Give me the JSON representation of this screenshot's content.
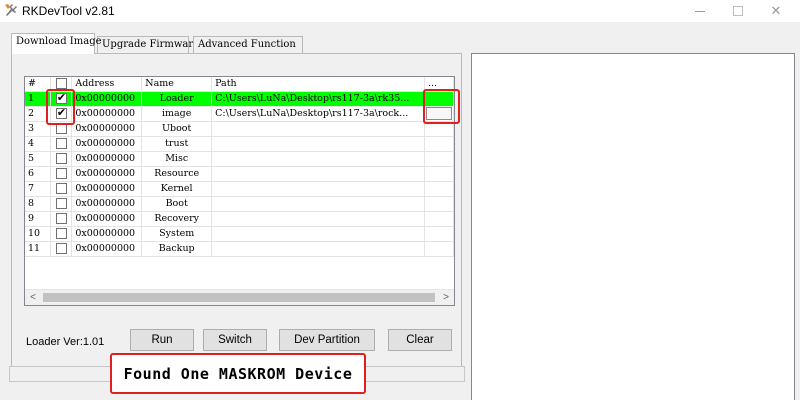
{
  "window": {
    "title": "RKDevTool v2.81",
    "icons": {
      "app": "rk-tool-icon",
      "minimize": "minimize-icon",
      "maximize": "maximize-icon",
      "close": "close-icon"
    }
  },
  "tabs": [
    {
      "label": "Download Image",
      "active": true
    },
    {
      "label": "Upgrade Firmware",
      "active": false
    },
    {
      "label": "Advanced Function",
      "active": false
    }
  ],
  "table": {
    "headers": {
      "num": "#",
      "check": "",
      "address": "Address",
      "name": "Name",
      "path": "Path",
      "browse": "..."
    },
    "rows": [
      {
        "num": "1",
        "checked": true,
        "address": "0x00000000",
        "name": "Loader",
        "path": "C:\\Users\\LuNa\\Desktop\\rs117-3a\\rk35...",
        "highlight": true
      },
      {
        "num": "2",
        "checked": true,
        "address": "0x00000000",
        "name": "image",
        "path": "C:\\Users\\LuNa\\Desktop\\rs117-3a\\rock...",
        "highlight": false
      },
      {
        "num": "3",
        "checked": false,
        "address": "0x00000000",
        "name": "Uboot",
        "path": "",
        "highlight": false
      },
      {
        "num": "4",
        "checked": false,
        "address": "0x00000000",
        "name": "trust",
        "path": "",
        "highlight": false
      },
      {
        "num": "5",
        "checked": false,
        "address": "0x00000000",
        "name": "Misc",
        "path": "",
        "highlight": false
      },
      {
        "num": "6",
        "checked": false,
        "address": "0x00000000",
        "name": "Resource",
        "path": "",
        "highlight": false
      },
      {
        "num": "7",
        "checked": false,
        "address": "0x00000000",
        "name": "Kernel",
        "path": "",
        "highlight": false
      },
      {
        "num": "8",
        "checked": false,
        "address": "0x00000000",
        "name": "Boot",
        "path": "",
        "highlight": false
      },
      {
        "num": "9",
        "checked": false,
        "address": "0x00000000",
        "name": "Recovery",
        "path": "",
        "highlight": false
      },
      {
        "num": "10",
        "checked": false,
        "address": "0x00000000",
        "name": "System",
        "path": "",
        "highlight": false
      },
      {
        "num": "11",
        "checked": false,
        "address": "0x00000000",
        "name": "Backup",
        "path": "",
        "highlight": false
      }
    ],
    "highlight_color": "#00ff00"
  },
  "scrollbar": {
    "left_arrow": "<",
    "right_arrow": ">"
  },
  "loader_version": "Loader Ver:1.01",
  "buttons": {
    "run": "Run",
    "switch": "Switch",
    "dev_partition": "Dev Partition",
    "clear": "Clear"
  },
  "status": {
    "message": "Found One MASKROM Device"
  },
  "annotation_color": "#e02020"
}
